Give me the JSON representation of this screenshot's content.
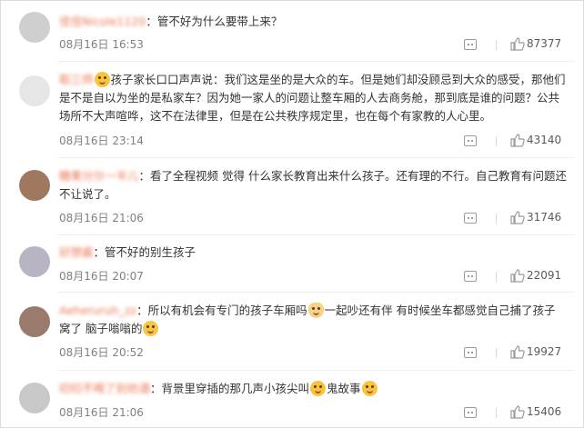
{
  "comments": [
    {
      "username": "佳佳Nicole1120",
      "segments": [
        "：管不好为什么要带上来？"
      ],
      "time": "08月16日 16:53",
      "likes": "87377",
      "avatar_color": "#c9c9c9"
    },
    {
      "username": "取三师",
      "segments": [
        "孩子家长口口声声说：我们这是坐的是大众的车。但是她们却没顾忌到大众的感受，那他们是不是自以为坐的是私家车？因为她一家人的问题让整车厢的人去商务舱，那到底是谁的问题？公共场所不大声喧哗，这不在法律里，但是在公共秩序规定里，也在每个有家教的人心里。"
      ],
      "time": "08月16日 23:14",
      "likes": "43140",
      "avatar_color": "#d8d8d8"
    },
    {
      "username": "糖果分分一半儿",
      "segments": [
        "：看了全程视频 觉得 什么家长教育出来什么孩子。还有理的不行。自己教育有问题还不让说了。"
      ],
      "time": "08月16日 21:06",
      "likes": "31746",
      "avatar_color": "#a07860"
    },
    {
      "username": "好想酱",
      "segments": [
        "：管不好的别生孩子"
      ],
      "time": "08月16日 20:07",
      "likes": "22091",
      "avatar_color": "#b8b4c4"
    },
    {
      "username": "Aeheruruh_zz",
      "segments": [
        "：所以有机会有专门的孩子车厢吗",
        "一起吵还有伴 有时候坐车都感觉自己捕了孩子窝了 脑子嗡嗡的"
      ],
      "time": "08月16日 20:52",
      "likes": "19927",
      "avatar_color": "#9a7a6a"
    },
    {
      "username": "叨叨不喝了别劝酒",
      "segments": [
        "：背景里穿插的那几声小孩尖叫",
        "鬼故事"
      ],
      "time": "08月16日 21:06",
      "likes": "15406",
      "avatar_color": "#c4c4c4"
    }
  ],
  "icons": {
    "reply": "comment-icon",
    "like": "thumbs-up-icon"
  },
  "colors": {
    "username": "#eb7350",
    "time": "#808080",
    "text": "#333333"
  }
}
